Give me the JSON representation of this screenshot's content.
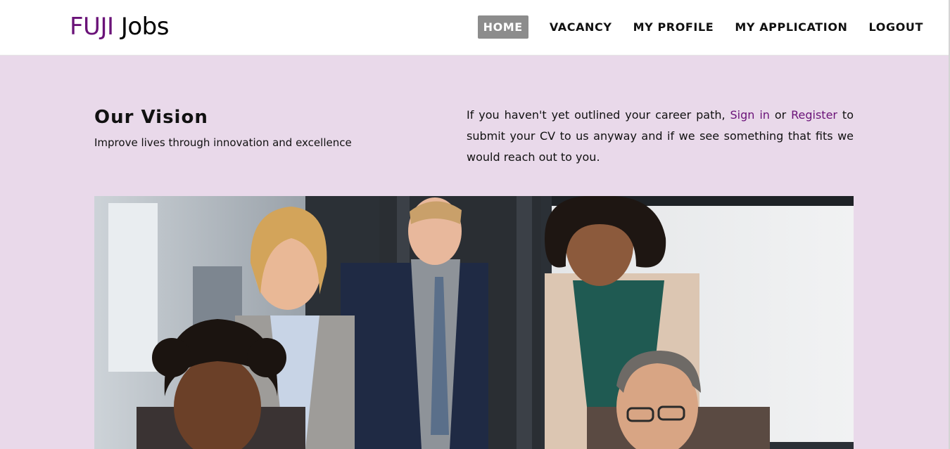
{
  "brand": {
    "part1": "FUJI",
    "part2": "Jobs"
  },
  "nav": {
    "items": [
      {
        "label": "HOME",
        "active": true
      },
      {
        "label": "VACANCY",
        "active": false
      },
      {
        "label": "MY PROFILE",
        "active": false
      },
      {
        "label": "MY APPLICATION",
        "active": false
      },
      {
        "label": "LOGOUT",
        "active": false
      }
    ]
  },
  "vision": {
    "title": "Our Vision",
    "subtitle": "Improve lives through innovation and excellence"
  },
  "intro": {
    "text_before": "If you haven't yet outlined your career path, ",
    "signin_link": "Sign in",
    "or_text": " or ",
    "register_link": "Register",
    "text_after": " to submit your CV to us anyway and if we see something that fits we would reach out to you."
  },
  "hero": {
    "image_name": "team-office-photo"
  },
  "colors": {
    "brand": "#6a1278",
    "background": "#e9d9ea",
    "active_nav": "#8c8c8c"
  }
}
